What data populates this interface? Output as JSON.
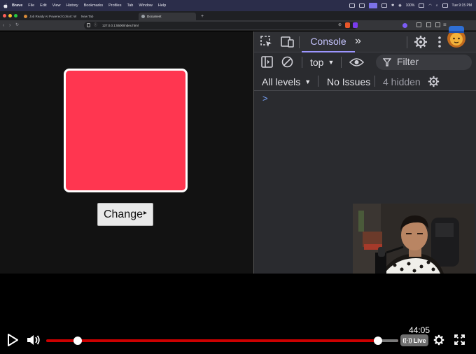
{
  "menubar": {
    "app_name": "Brave",
    "menus": [
      "File",
      "Edit",
      "View",
      "History",
      "Bookmarks",
      "Profiles",
      "Tab",
      "Window",
      "Help"
    ],
    "battery": "100%",
    "clock": "Tue 9:15 PM"
  },
  "tabs": [
    {
      "label": "Job Ready AI Powered Cohort: W"
    },
    {
      "label": "New Tab"
    },
    {
      "label": "Document"
    }
  ],
  "new_tab_label": "+",
  "address": {
    "url": "127.0.0.1:5500/index.html"
  },
  "page": {
    "box_color": "#ff3650",
    "button_label": "Change"
  },
  "devtools": {
    "active_tab": "Console",
    "context": "top",
    "filter_placeholder": "Filter",
    "levels": "All levels",
    "issues": "No Issues",
    "hidden": "4 hidden",
    "prompt": ">"
  },
  "player": {
    "time": "44:05",
    "live_label": "Live",
    "progress_fraction": 0.94
  },
  "colors": {
    "accent": "#9c95ff",
    "progress": "#cc0000"
  }
}
